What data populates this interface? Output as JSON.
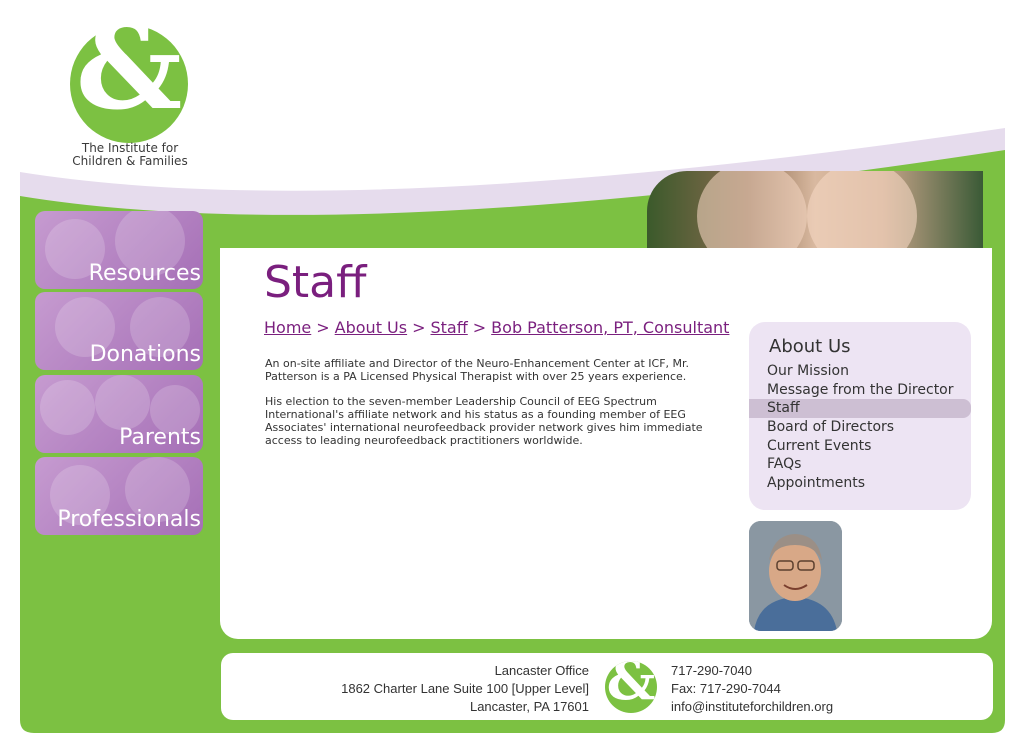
{
  "logo": {
    "symbol": "&",
    "line1": "The Institute for",
    "line2": "Children & Families"
  },
  "nav": {
    "resources": "Resources",
    "donations": "Donations",
    "parents": "Parents",
    "professionals": "Professionals"
  },
  "page": {
    "title": "Staff",
    "breadcrumb": {
      "home": "Home",
      "about": "About Us",
      "staff": "Staff",
      "current": "Bob Patterson, PT, Consultant",
      "separator": ">"
    },
    "paragraphs": [
      "An on-site affiliate and Director of the Neuro-Enhancement Center at ICF, Mr. Patterson is a PA Licensed Physical Therapist with over 25 years experience.",
      "His election to the seven-member Leadership Council of EEG Spectrum International's affiliate network and his status as a founding member of EEG Associates' international neurofeedback provider network gives him immediate access to leading neurofeedback practitioners worldwide."
    ]
  },
  "sidebar": {
    "title": "About Us",
    "items": [
      "Our Mission",
      "Message from the Director",
      "Staff",
      "Board of Directors",
      "Current Events",
      "FAQs",
      "Appointments"
    ],
    "active_index": 2
  },
  "footer": {
    "office": "Lancaster Office",
    "address1": "1862 Charter Lane Suite 100 [Upper Level]",
    "address2": "Lancaster, PA 17601",
    "phone": "717-290-7040",
    "fax": "Fax: 717-290-7044",
    "email": "info@instituteforchildren.org"
  },
  "colors": {
    "green": "#7cc142",
    "purple": "#7a1f7e",
    "lavender": "#ede4f3",
    "tile_purple": "#b583c4"
  }
}
